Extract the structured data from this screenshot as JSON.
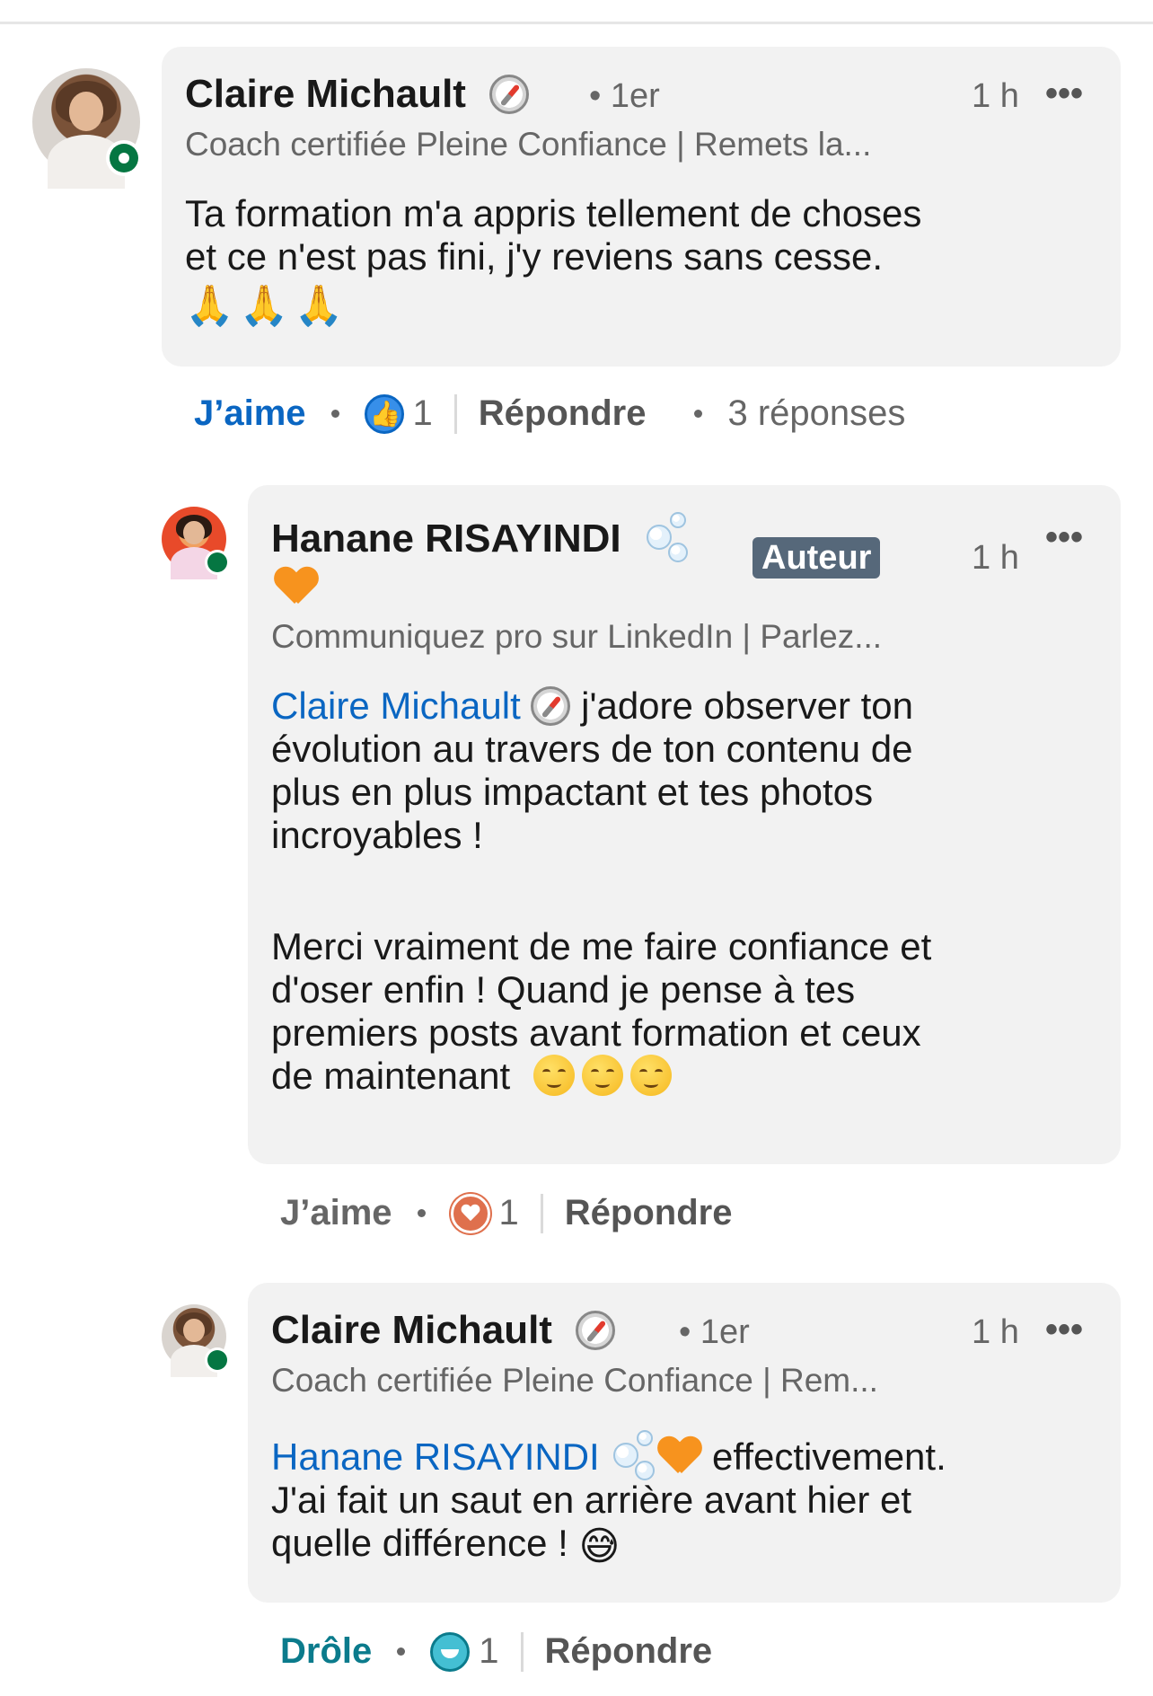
{
  "comments": [
    {
      "author": "Claire Michault",
      "degree": "• 1er",
      "time": "1 h",
      "more": "•••",
      "headline": "Coach certifiée Pleine Confiance | Remets la...",
      "body_line1": "Ta formation m'a appris tellement de choses",
      "body_line2": "et ce n'est pas fini, j'y reviens sans cesse.",
      "body_emoji": "🙏🙏🙏",
      "actions": {
        "like": "J’aime",
        "reaction_count": "1",
        "reply": "Répondre",
        "replies": "3 réponses"
      }
    }
  ],
  "replies": [
    {
      "author": "Hanane RISAYINDI",
      "badge": "Auteur",
      "time": "1 h",
      "more": "•••",
      "headline": "Communiquez pro sur LinkedIn | Parlez...",
      "mention": "Claire Michault",
      "p1_rest": " j'adore observer ton",
      "p1_line2": "évolution au travers de ton contenu de",
      "p1_line3": "plus en plus impactant et tes photos",
      "p1_line4": "incroyables !",
      "p2_line1": "Merci vraiment de me faire confiance et",
      "p2_line2": "d'oser enfin ! Quand je pense à tes",
      "p2_line3": "premiers posts avant formation et ceux",
      "p2_line4": "de maintenant",
      "actions": {
        "like": "J’aime",
        "reaction_count": "1",
        "reply": "Répondre"
      }
    },
    {
      "author": "Claire Michault",
      "degree": "• 1er",
      "time": "1 h",
      "more": "•••",
      "headline": "Coach certifiée Pleine Confiance | Rem...",
      "mention": "Hanane RISAYINDI",
      "line1_rest": " effectivement.",
      "line2": "J'ai fait un saut en arrière avant hier et",
      "line3": "quelle différence !",
      "line3_emoji": "😅",
      "actions": {
        "like": "Drôle",
        "reaction_count": "1",
        "reply": "Répondre"
      }
    }
  ],
  "colors": {
    "like_blue": "#0a66c2",
    "funny_teal": "#0b7b8c",
    "action_gray": "#666666",
    "online_green": "#057642"
  },
  "icons": [
    "compass-icon",
    "bubbles-icon",
    "orange-heart-icon",
    "like-reaction-icon",
    "love-reaction-icon",
    "funny-reaction-icon",
    "more-icon"
  ]
}
